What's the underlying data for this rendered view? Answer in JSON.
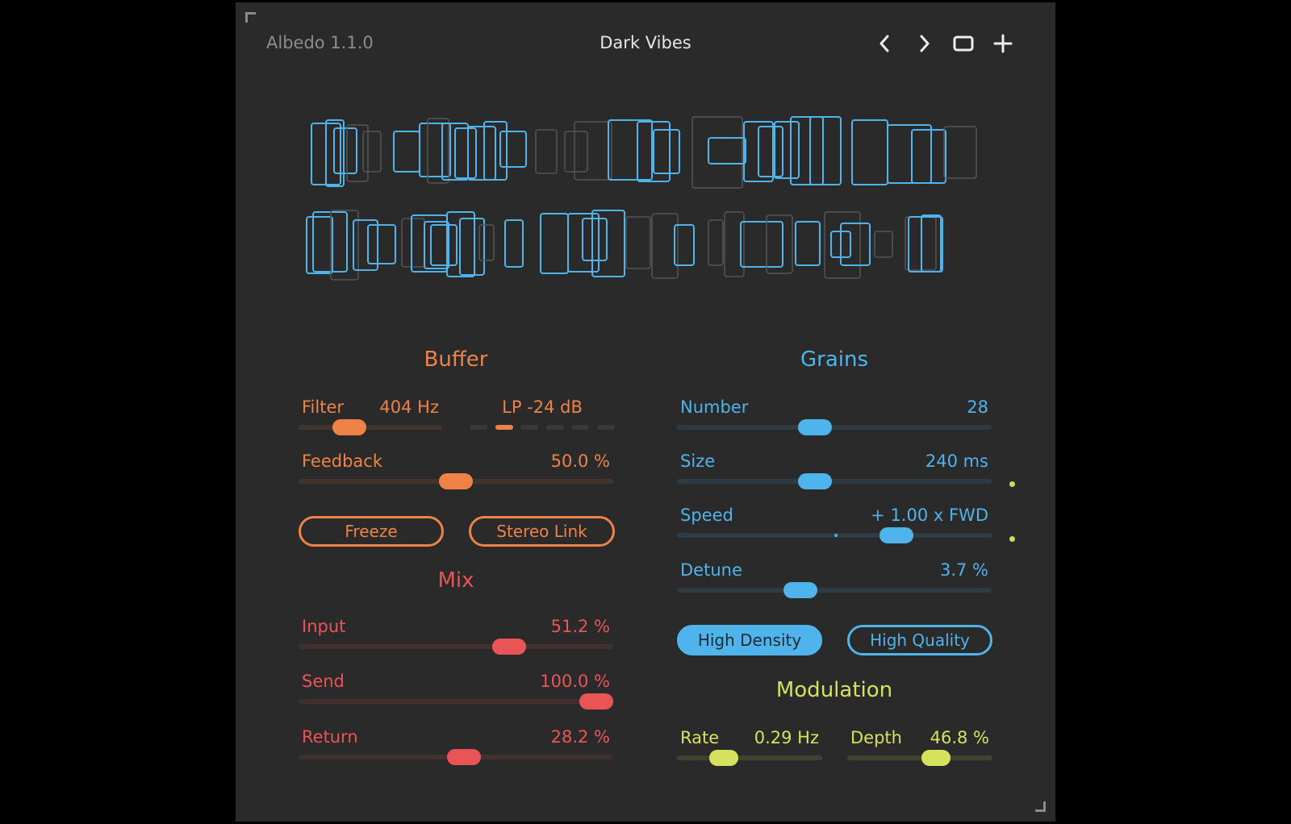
{
  "header": {
    "app_title": "Albedo 1.1.0",
    "preset_name": "Dark Vibes",
    "prev_icon": "chevron-left-icon",
    "next_icon": "chevron-right-icon",
    "window_icon": "window-icon",
    "add_icon": "plus-icon"
  },
  "colors": {
    "background": "#2a2a2a",
    "buffer": "#ef8347",
    "mix": "#e95557",
    "grains": "#4fb3ec",
    "modulation": "#d6e15c",
    "grain_ghost": "#555555"
  },
  "buffer": {
    "title": "Buffer",
    "filter": {
      "label": "Filter",
      "value": "404 Hz",
      "position": 0.31
    },
    "filter_type": {
      "value": "LP -24 dB",
      "segments": 6,
      "selected_index": 1
    },
    "feedback": {
      "label": "Feedback",
      "value": "50.0 %",
      "position": 0.5
    },
    "freeze_label": "Freeze",
    "stereo_link_label": "Stereo Link"
  },
  "mix": {
    "title": "Mix",
    "input": {
      "label": "Input",
      "value": "51.2 %",
      "position": 0.69
    },
    "send": {
      "label": "Send",
      "value": "100.0 %",
      "position": 1.0
    },
    "return": {
      "label": "Return",
      "value": "28.2 %",
      "position": 0.53
    }
  },
  "grains": {
    "title": "Grains",
    "number": {
      "label": "Number",
      "value": "28",
      "position": 0.43
    },
    "size": {
      "label": "Size",
      "value": "240 ms",
      "position": 0.43
    },
    "speed": {
      "label": "Speed",
      "value": "+ 1.00 x FWD",
      "position": 0.72
    },
    "detune": {
      "label": "Detune",
      "value": "3.7 %",
      "position": 0.38
    },
    "high_density_label": "High Density",
    "high_quality_label": "High Quality"
  },
  "modulation": {
    "title": "Modulation",
    "rate": {
      "label": "Rate",
      "value": "0.29 Hz",
      "position": 0.28
    },
    "depth": {
      "label": "Depth",
      "value": "46.8 %",
      "position": 0.64
    }
  }
}
